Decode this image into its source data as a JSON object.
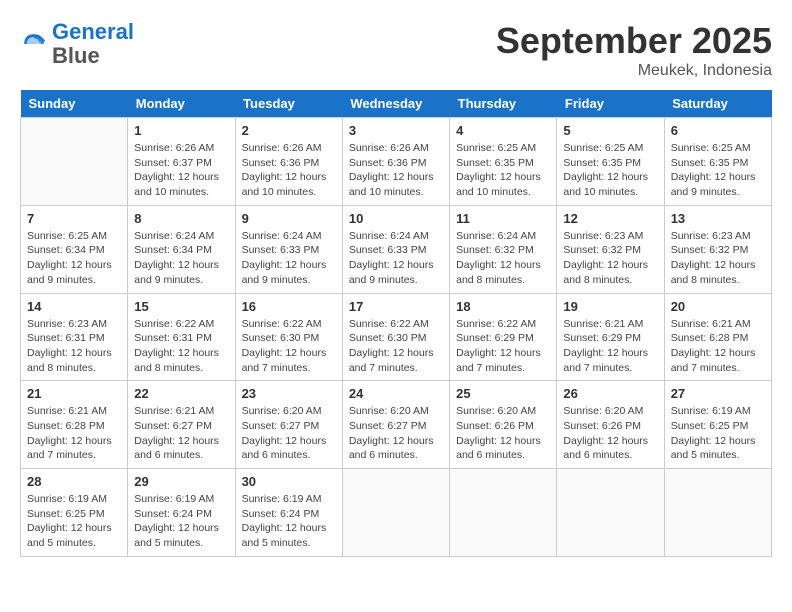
{
  "header": {
    "logo_line1": "General",
    "logo_line2": "Blue",
    "month": "September 2025",
    "location": "Meukek, Indonesia"
  },
  "days_of_week": [
    "Sunday",
    "Monday",
    "Tuesday",
    "Wednesday",
    "Thursday",
    "Friday",
    "Saturday"
  ],
  "weeks": [
    [
      {
        "day": "",
        "info": ""
      },
      {
        "day": "1",
        "info": "Sunrise: 6:26 AM\nSunset: 6:37 PM\nDaylight: 12 hours and 10 minutes."
      },
      {
        "day": "2",
        "info": "Sunrise: 6:26 AM\nSunset: 6:36 PM\nDaylight: 12 hours and 10 minutes."
      },
      {
        "day": "3",
        "info": "Sunrise: 6:26 AM\nSunset: 6:36 PM\nDaylight: 12 hours and 10 minutes."
      },
      {
        "day": "4",
        "info": "Sunrise: 6:25 AM\nSunset: 6:35 PM\nDaylight: 12 hours and 10 minutes."
      },
      {
        "day": "5",
        "info": "Sunrise: 6:25 AM\nSunset: 6:35 PM\nDaylight: 12 hours and 10 minutes."
      },
      {
        "day": "6",
        "info": "Sunrise: 6:25 AM\nSunset: 6:35 PM\nDaylight: 12 hours and 9 minutes."
      }
    ],
    [
      {
        "day": "7",
        "info": "Sunrise: 6:25 AM\nSunset: 6:34 PM\nDaylight: 12 hours and 9 minutes."
      },
      {
        "day": "8",
        "info": "Sunrise: 6:24 AM\nSunset: 6:34 PM\nDaylight: 12 hours and 9 minutes."
      },
      {
        "day": "9",
        "info": "Sunrise: 6:24 AM\nSunset: 6:33 PM\nDaylight: 12 hours and 9 minutes."
      },
      {
        "day": "10",
        "info": "Sunrise: 6:24 AM\nSunset: 6:33 PM\nDaylight: 12 hours and 9 minutes."
      },
      {
        "day": "11",
        "info": "Sunrise: 6:24 AM\nSunset: 6:32 PM\nDaylight: 12 hours and 8 minutes."
      },
      {
        "day": "12",
        "info": "Sunrise: 6:23 AM\nSunset: 6:32 PM\nDaylight: 12 hours and 8 minutes."
      },
      {
        "day": "13",
        "info": "Sunrise: 6:23 AM\nSunset: 6:32 PM\nDaylight: 12 hours and 8 minutes."
      }
    ],
    [
      {
        "day": "14",
        "info": "Sunrise: 6:23 AM\nSunset: 6:31 PM\nDaylight: 12 hours and 8 minutes."
      },
      {
        "day": "15",
        "info": "Sunrise: 6:22 AM\nSunset: 6:31 PM\nDaylight: 12 hours and 8 minutes."
      },
      {
        "day": "16",
        "info": "Sunrise: 6:22 AM\nSunset: 6:30 PM\nDaylight: 12 hours and 7 minutes."
      },
      {
        "day": "17",
        "info": "Sunrise: 6:22 AM\nSunset: 6:30 PM\nDaylight: 12 hours and 7 minutes."
      },
      {
        "day": "18",
        "info": "Sunrise: 6:22 AM\nSunset: 6:29 PM\nDaylight: 12 hours and 7 minutes."
      },
      {
        "day": "19",
        "info": "Sunrise: 6:21 AM\nSunset: 6:29 PM\nDaylight: 12 hours and 7 minutes."
      },
      {
        "day": "20",
        "info": "Sunrise: 6:21 AM\nSunset: 6:28 PM\nDaylight: 12 hours and 7 minutes."
      }
    ],
    [
      {
        "day": "21",
        "info": "Sunrise: 6:21 AM\nSunset: 6:28 PM\nDaylight: 12 hours and 7 minutes."
      },
      {
        "day": "22",
        "info": "Sunrise: 6:21 AM\nSunset: 6:27 PM\nDaylight: 12 hours and 6 minutes."
      },
      {
        "day": "23",
        "info": "Sunrise: 6:20 AM\nSunset: 6:27 PM\nDaylight: 12 hours and 6 minutes."
      },
      {
        "day": "24",
        "info": "Sunrise: 6:20 AM\nSunset: 6:27 PM\nDaylight: 12 hours and 6 minutes."
      },
      {
        "day": "25",
        "info": "Sunrise: 6:20 AM\nSunset: 6:26 PM\nDaylight: 12 hours and 6 minutes."
      },
      {
        "day": "26",
        "info": "Sunrise: 6:20 AM\nSunset: 6:26 PM\nDaylight: 12 hours and 6 minutes."
      },
      {
        "day": "27",
        "info": "Sunrise: 6:19 AM\nSunset: 6:25 PM\nDaylight: 12 hours and 5 minutes."
      }
    ],
    [
      {
        "day": "28",
        "info": "Sunrise: 6:19 AM\nSunset: 6:25 PM\nDaylight: 12 hours and 5 minutes."
      },
      {
        "day": "29",
        "info": "Sunrise: 6:19 AM\nSunset: 6:24 PM\nDaylight: 12 hours and 5 minutes."
      },
      {
        "day": "30",
        "info": "Sunrise: 6:19 AM\nSunset: 6:24 PM\nDaylight: 12 hours and 5 minutes."
      },
      {
        "day": "",
        "info": ""
      },
      {
        "day": "",
        "info": ""
      },
      {
        "day": "",
        "info": ""
      },
      {
        "day": "",
        "info": ""
      }
    ]
  ]
}
